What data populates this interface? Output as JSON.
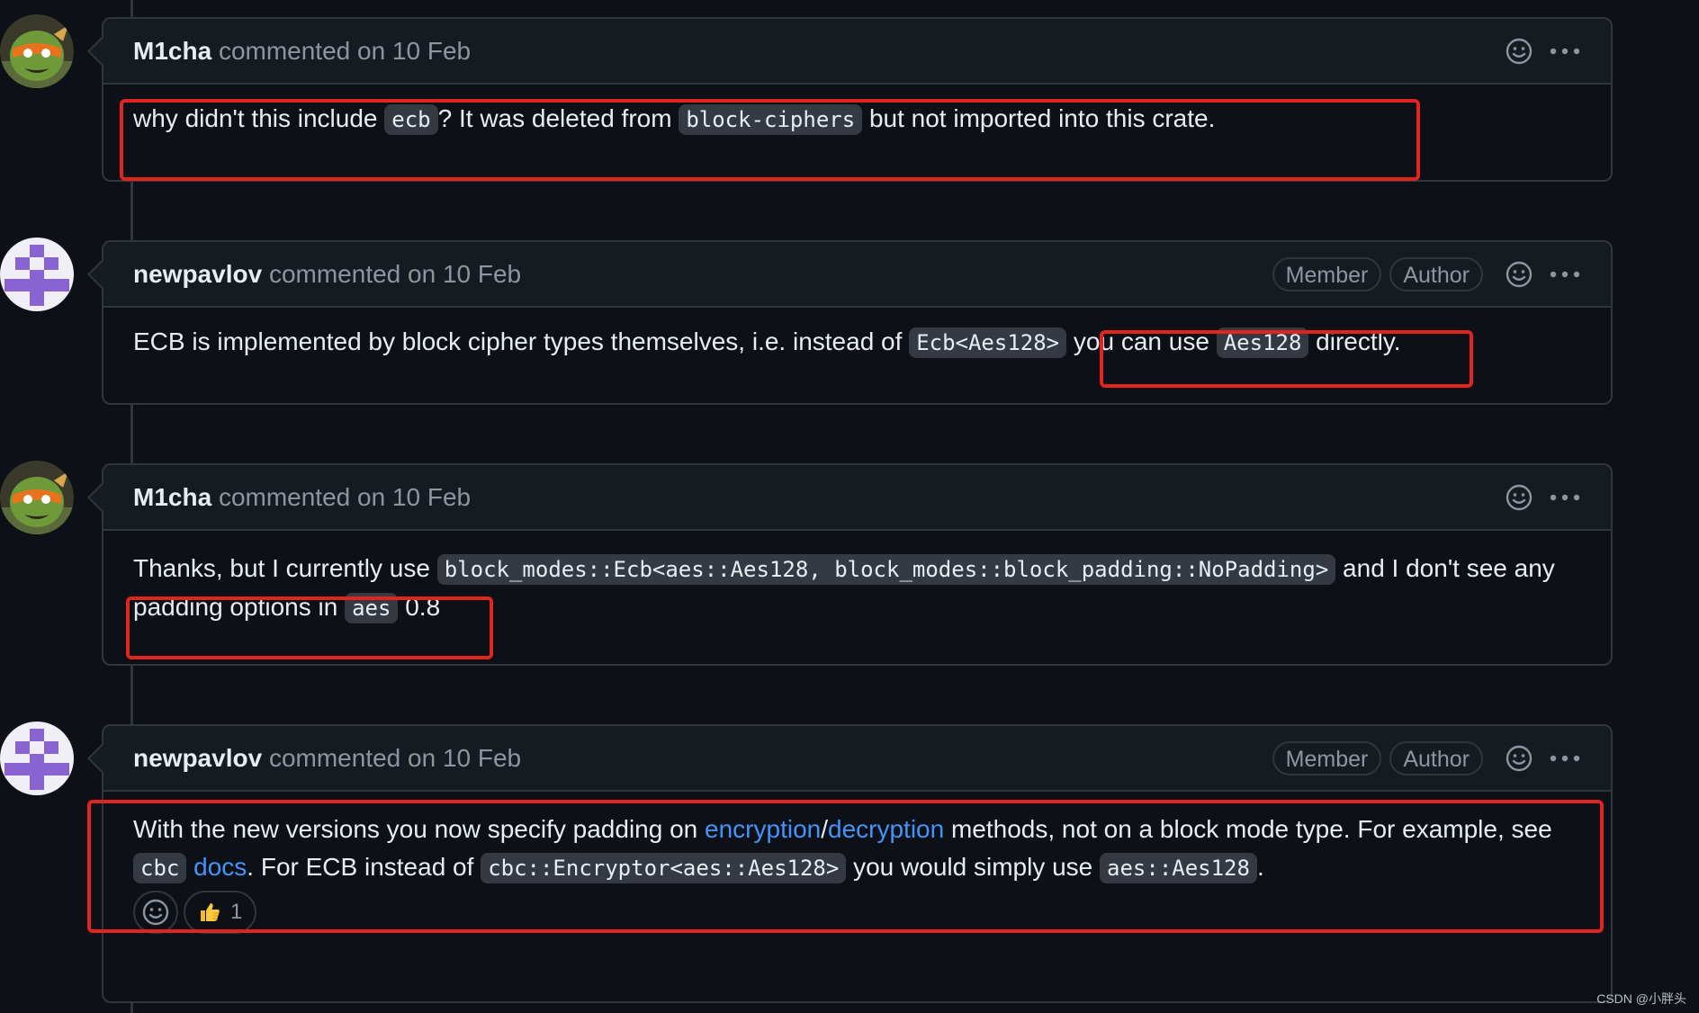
{
  "comments": [
    {
      "author": "M1cha",
      "action": "commented on 10 Feb",
      "badges": [],
      "body": [
        {
          "t": "why didn't this include "
        },
        {
          "c": "ecb"
        },
        {
          "t": "? It was deleted from "
        },
        {
          "c": "block-ciphers"
        },
        {
          "t": " but not imported into this crate."
        }
      ]
    },
    {
      "author": "newpavlov",
      "action": "commented on 10 Feb",
      "badges": [
        "Member",
        "Author"
      ],
      "body": [
        {
          "t": "ECB is implemented by block cipher types themselves, i.e. instead of "
        },
        {
          "c": "Ecb<Aes128>"
        },
        {
          "t": " you can use "
        },
        {
          "c": "Aes128"
        },
        {
          "t": " directly."
        }
      ]
    },
    {
      "author": "M1cha",
      "action": "commented on 10 Feb",
      "badges": [],
      "body": [
        {
          "t": "Thanks, but I currently use "
        },
        {
          "c": "block_modes::Ecb<aes::Aes128, block_modes::block_padding::NoPadding>"
        },
        {
          "t": " and I don't see any padding options in "
        },
        {
          "c": "aes"
        },
        {
          "t": " 0.8"
        }
      ]
    },
    {
      "author": "newpavlov",
      "action": "commented on 10 Feb",
      "badges": [
        "Member",
        "Author"
      ],
      "body": [
        {
          "t": "With the new versions you now specify padding on "
        },
        {
          "l": "encryption"
        },
        {
          "t": "/"
        },
        {
          "l": "decryption"
        },
        {
          "t": " methods, not on a block mode type. For example, see "
        },
        {
          "c": "cbc"
        },
        {
          "t": " "
        },
        {
          "l": "docs"
        },
        {
          "t": ". For ECB instead of "
        },
        {
          "c": "cbc::Encryptor<aes::Aes128>"
        },
        {
          "t": " you would simply use "
        },
        {
          "c": "aes::Aes128"
        },
        {
          "t": "."
        }
      ],
      "reactions": [
        {
          "emoji": "thumbs-up",
          "count": "1"
        }
      ]
    }
  ],
  "watermark": "CSDN @小胖头",
  "colors": {
    "background": "#0d1117",
    "header_background": "#161b22",
    "border": "#30363d",
    "text": "#e6edf3",
    "muted": "#8d96a0",
    "link": "#4493f8",
    "code_background": "#343942",
    "highlight": "#e0241e"
  }
}
